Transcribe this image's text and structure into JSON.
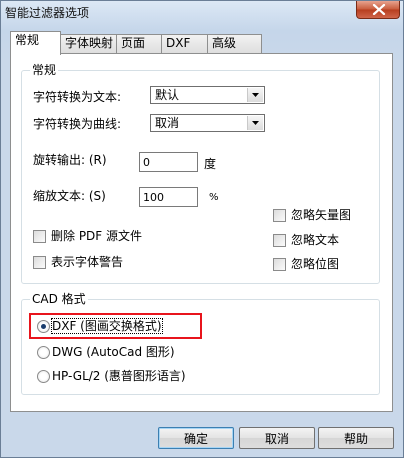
{
  "window": {
    "title": "智能过滤器选项",
    "close_icon": "close-icon"
  },
  "tabs": [
    {
      "label": "常规",
      "active": true
    },
    {
      "label": "字体映射",
      "active": false
    },
    {
      "label": "页面",
      "active": false
    },
    {
      "label": "DXF",
      "active": false
    },
    {
      "label": "高级",
      "active": false
    }
  ],
  "general_group": {
    "title": "常规",
    "text_conversion": {
      "label": "字符转换为文本:",
      "value": "默认"
    },
    "curve_conversion": {
      "label": "字符转换为曲线:",
      "value": "取消"
    },
    "rotate_output": {
      "label": "旋转输出: (R)",
      "value": "0",
      "unit": "度"
    },
    "scale_text": {
      "label": "缩放文本: (S)",
      "value": "100",
      "unit": "%"
    },
    "checkboxes": [
      {
        "label": "忽略矢量图",
        "checked": false
      },
      {
        "label": "删除 PDF 源文件",
        "checked": false
      },
      {
        "label": "忽略文本",
        "checked": false
      },
      {
        "label": "表示字体警告",
        "checked": false
      },
      {
        "label": "忽略位图",
        "checked": false
      }
    ]
  },
  "cad_group": {
    "title": "CAD 格式",
    "options": [
      {
        "label": "DXF (图画交换格式)",
        "selected": true
      },
      {
        "label": "DWG (AutoCad 图形)",
        "selected": false
      },
      {
        "label": "HP-GL/2 (惠普图形语言)",
        "selected": false
      }
    ]
  },
  "buttons": {
    "ok": "确定",
    "cancel": "取消",
    "help": "帮助"
  },
  "colors": {
    "highlight": "#e8141c",
    "close": "#c75a3a"
  }
}
